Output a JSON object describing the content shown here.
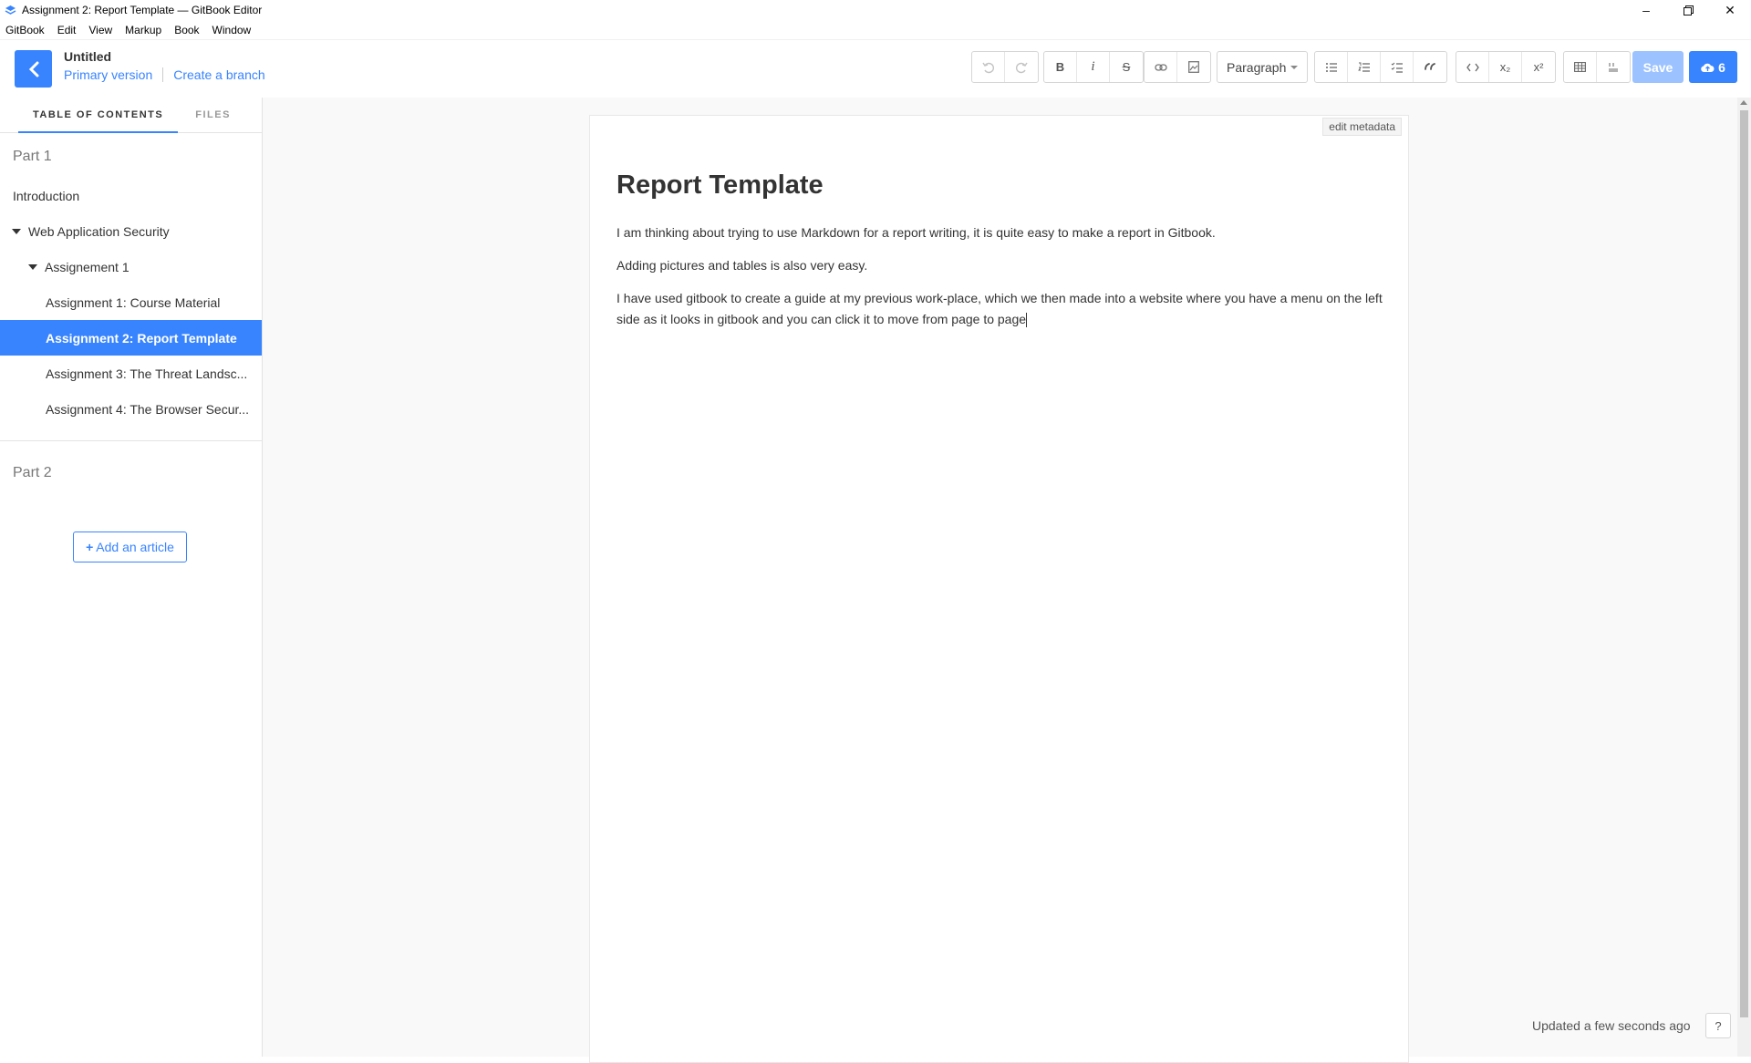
{
  "window": {
    "title": "Assignment 2: Report Template — GitBook Editor",
    "controls": [
      "minimize-icon",
      "restore-icon",
      "close-icon"
    ]
  },
  "menubar": {
    "items": [
      "GitBook",
      "Edit",
      "View",
      "Markup",
      "Book",
      "Window"
    ]
  },
  "header": {
    "book_title": "Untitled",
    "primary_version": "Primary version",
    "create_branch": "Create a branch",
    "toolbar": {
      "paragraph_label": "Paragraph",
      "bold": "B",
      "italic": "i",
      "strike": "S",
      "subscript": "x₂",
      "superscript": "x²"
    },
    "save_label": "Save",
    "sync_count": "6",
    "colors": {
      "accent": "#3884ff",
      "save_disabled": "#9cc3ff"
    }
  },
  "sidebar": {
    "tabs": [
      "TABLE OF CONTENTS",
      "FILES"
    ],
    "part1": "Part 1",
    "items": [
      {
        "label": "Introduction",
        "level": 0,
        "caret": false
      },
      {
        "label": "Web Application Security",
        "level": 0,
        "caret": true
      },
      {
        "label": "Assignement 1",
        "level": 1,
        "caret": true
      },
      {
        "label": "Assignment 1: Course Material",
        "level": 2,
        "caret": false
      },
      {
        "label": "Assignment 2: Report Template",
        "level": 2,
        "caret": false,
        "active": true
      },
      {
        "label": "Assignment 3: The Threat Landsc...",
        "level": 2,
        "caret": false
      },
      {
        "label": "Assignment 4: The Browser Secur...",
        "level": 2,
        "caret": false
      }
    ],
    "part2": "Part 2",
    "add_article": "Add an article"
  },
  "editor": {
    "edit_metadata": "edit metadata",
    "heading": "Report Template",
    "paragraphs": [
      "I am thinking about trying to use Markdown for a report writing, it is quite easy to make a report in Gitbook.",
      "Adding pictures and tables is also very easy.",
      "I have used gitbook to create a guide at my previous work-place, which we then made into a website where you have a menu on the left side as it looks in gitbook and you can click it to move from page to page"
    ]
  },
  "status": {
    "updated": "Updated a few seconds ago",
    "help": "?"
  }
}
